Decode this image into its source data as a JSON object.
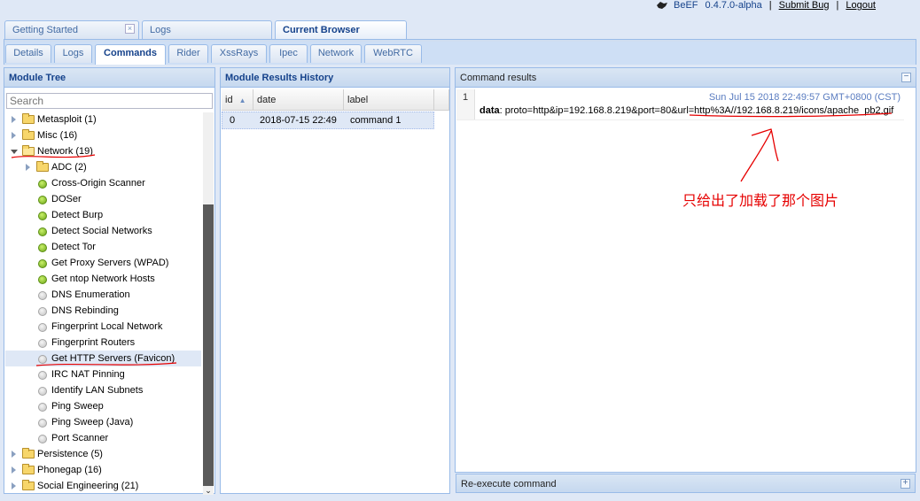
{
  "brand": {
    "name": "BeEF",
    "version": "0.4.7.0-alpha",
    "submit_bug": "Submit  Bug",
    "logout": "Logout",
    "separator": "|"
  },
  "main_tabs": [
    {
      "label": "Getting Started",
      "closable": true,
      "active": false
    },
    {
      "label": "Logs",
      "active": false
    },
    {
      "label": "Current Browser",
      "active": true
    }
  ],
  "sub_tabs": [
    {
      "label": "Details"
    },
    {
      "label": "Logs"
    },
    {
      "label": "Commands",
      "active": true
    },
    {
      "label": "Rider"
    },
    {
      "label": "XssRays"
    },
    {
      "label": "Ipec"
    },
    {
      "label": "Network"
    },
    {
      "label": "WebRTC"
    }
  ],
  "module_tree": {
    "title": "Module Tree",
    "search_placeholder": "Search",
    "items": [
      {
        "label": "Metasploit (1)",
        "type": "folder"
      },
      {
        "label": "Misc (16)",
        "type": "folder"
      },
      {
        "label": "Network (19)",
        "type": "folder-open"
      },
      {
        "label": "ADC (2)",
        "type": "folder"
      },
      {
        "label": "Cross-Origin Scanner",
        "status": "green"
      },
      {
        "label": "DOSer",
        "status": "green"
      },
      {
        "label": "Detect Burp",
        "status": "green"
      },
      {
        "label": "Detect Social Networks",
        "status": "green"
      },
      {
        "label": "Detect Tor",
        "status": "green"
      },
      {
        "label": "Get Proxy Servers (WPAD)",
        "status": "green"
      },
      {
        "label": "Get ntop Network Hosts",
        "status": "green"
      },
      {
        "label": "DNS Enumeration",
        "status": "grey"
      },
      {
        "label": "DNS Rebinding",
        "status": "grey"
      },
      {
        "label": "Fingerprint Local Network",
        "status": "grey"
      },
      {
        "label": "Fingerprint Routers",
        "status": "grey"
      },
      {
        "label": "Get HTTP Servers (Favicon)",
        "status": "grey",
        "selected": true
      },
      {
        "label": "IRC NAT Pinning",
        "status": "grey"
      },
      {
        "label": "Identify LAN Subnets",
        "status": "grey"
      },
      {
        "label": "Ping Sweep",
        "status": "grey"
      },
      {
        "label": "Ping Sweep (Java)",
        "status": "grey"
      },
      {
        "label": "Port Scanner",
        "status": "grey"
      },
      {
        "label": "Persistence (5)",
        "type": "folder"
      },
      {
        "label": "Phonegap (16)",
        "type": "folder"
      },
      {
        "label": "Social Engineering (21)",
        "type": "folder"
      }
    ]
  },
  "module_results": {
    "title": "Module Results History",
    "columns": [
      "id",
      "date",
      "label"
    ],
    "rows": [
      {
        "id": "0",
        "date": "2018-07-15 22:49",
        "label": "command 1"
      }
    ]
  },
  "command_results": {
    "title": "Command results",
    "number": "1",
    "date": "Sun Jul 15 2018 22:49:57 GMT+0800 (CST)",
    "data_key": "data",
    "data_value": ": proto=http&ip=192.168.8.219&port=80&url=http%3A//192.168.8.219/icons/apache_pb2.gif",
    "annotation": "只给出了加载了那个图片"
  },
  "re_execute": {
    "label": "Re-execute command"
  },
  "colors": {
    "accent": "#15428b",
    "annotation": "#e60000",
    "border": "#99bbe8"
  }
}
